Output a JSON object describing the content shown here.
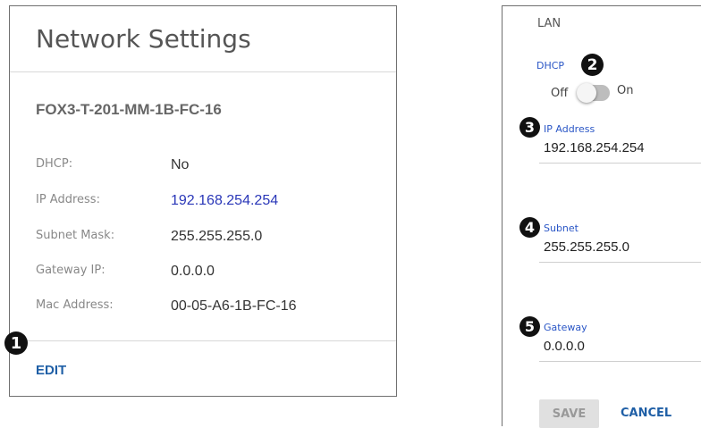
{
  "left_card": {
    "title": "Network Settings",
    "device_name": "FOX3-T-201-MM-1B-FC-16",
    "rows": [
      {
        "label": "DHCP:",
        "value": "No"
      },
      {
        "label": "IP Address:",
        "value": "192.168.254.254"
      },
      {
        "label": "Subnet Mask:",
        "value": "255.255.255.0"
      },
      {
        "label": "Gateway IP:",
        "value": "0.0.0.0"
      },
      {
        "label": "Mac Address:",
        "value": "00-05-A6-1B-FC-16"
      }
    ],
    "edit_label": "EDIT"
  },
  "right_panel": {
    "section_title": "LAN",
    "dhcp_label": "DHCP",
    "toggle_off": "Off",
    "toggle_on": "On",
    "ip_label": "IP Address",
    "ip_value": "192.168.254.254",
    "subnet_label": "Subnet",
    "subnet_value": "255.255.255.0",
    "gateway_label": "Gateway",
    "gateway_value": "0.0.0.0",
    "save_label": "SAVE",
    "cancel_label": "CANCEL"
  },
  "callouts": [
    "1",
    "2",
    "3",
    "4",
    "5"
  ],
  "colors": {
    "link_blue": "#1f5fa6",
    "field_label_blue": "#2a56c6",
    "ip_value_blue": "#2a37b8"
  }
}
